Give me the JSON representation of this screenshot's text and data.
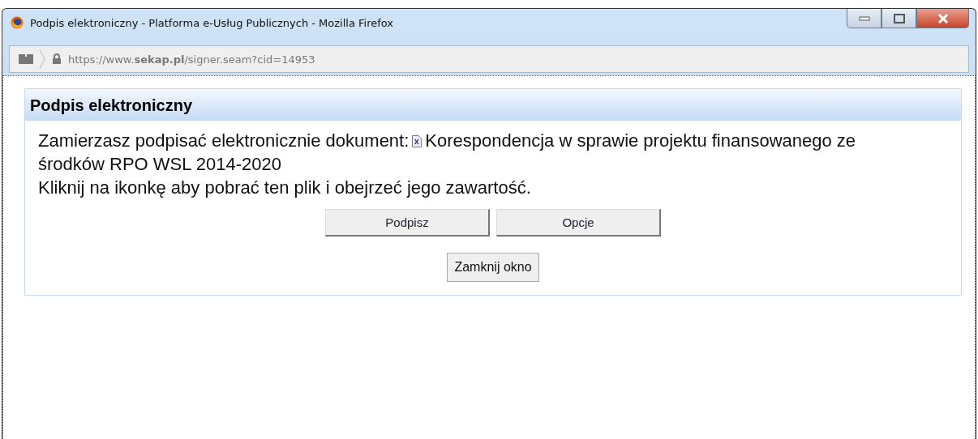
{
  "window": {
    "title": "Podpis elektroniczny - Platforma e-Usług Publicznych - Mozilla Firefox"
  },
  "address_bar": {
    "url": "https://www.**sekap.pl**/signer.seam?cid=14953"
  },
  "panel": {
    "title": "Podpis elektroniczny",
    "message": "Zamierzasz podpisać elektronicznie dokument:",
    "document_name_lines": [
      "Korespondencja w sprawie projektu finansowanego ze",
      "środków RPO WSL 2014-2020"
    ],
    "hint": "Kliknij na ikonkę aby pobrać ten plik i obejrzeć jego zawartość.",
    "buttons": [
      "Podpisz",
      "Opcje"
    ],
    "close_button": "Zamknij okno"
  }
}
